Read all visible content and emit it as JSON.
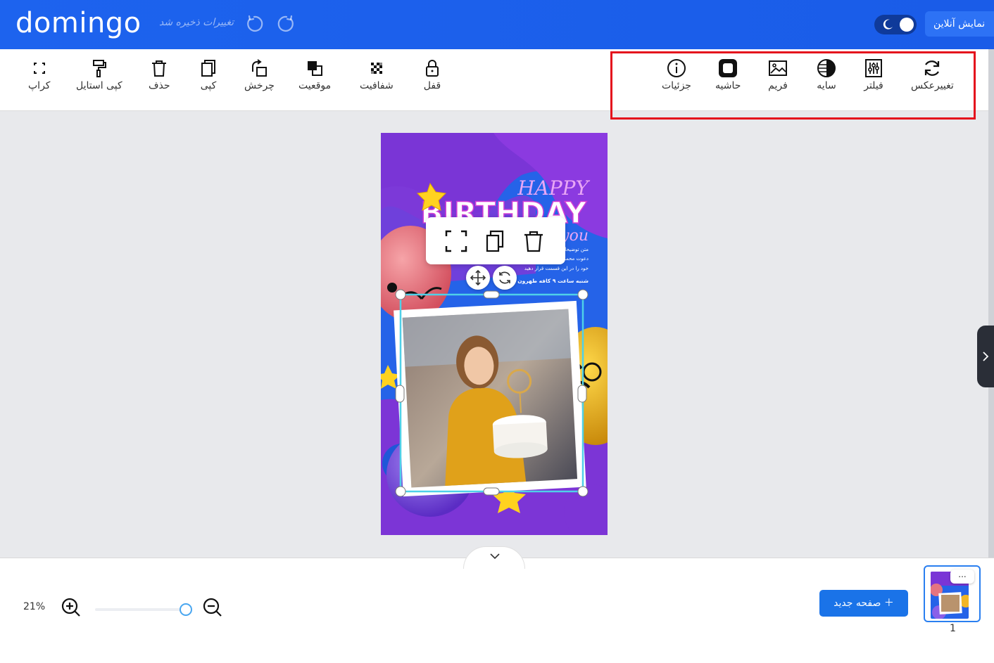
{
  "header": {
    "logo": "domingo",
    "save_status": "تغییرات ذخیره شد",
    "online_button": "نمایش آنلاین"
  },
  "toolbar_left": [
    {
      "label": "کراپ",
      "icon": "crop-icon"
    },
    {
      "label": "کپی استایل",
      "icon": "paint-roller-icon"
    },
    {
      "label": "حذف",
      "icon": "trash-icon"
    },
    {
      "label": "کپی",
      "icon": "copy-icon"
    },
    {
      "label": "چرخش",
      "icon": "rotate-icon"
    },
    {
      "label": "موقعیت",
      "icon": "layers-icon"
    },
    {
      "label": "شفافیت",
      "icon": "transparency-icon"
    },
    {
      "label": "قفل",
      "icon": "lock-icon"
    }
  ],
  "toolbar_right": [
    {
      "label": "جزئیات",
      "icon": "info-icon"
    },
    {
      "label": "حاشیه",
      "icon": "border-icon"
    },
    {
      "label": "فریم",
      "icon": "image-frame-icon"
    },
    {
      "label": "سایه",
      "icon": "shadow-icon"
    },
    {
      "label": "فیلتر",
      "icon": "filter-icon"
    },
    {
      "label": "تغییرعکس",
      "icon": "replace-image-icon"
    }
  ],
  "design": {
    "title_1": "HAPPY",
    "title_2": "BIRTHDAY",
    "title_3": "you",
    "lines": [
      "متن توضیحا",
      "دعوت محمد",
      "خود را در این قسمت قرار دهید",
      "شنبه ساعت ۹ کافه طهرون"
    ]
  },
  "bottom": {
    "zoom": "21%",
    "new_page": "صفحه جدید",
    "thumb_menu": "...",
    "page_number": "1"
  },
  "colors": {
    "header_bg": "#1d63ee",
    "accent": "#1a73e8",
    "highlight_box": "#e4101c",
    "selection": "#4fd0e8"
  }
}
